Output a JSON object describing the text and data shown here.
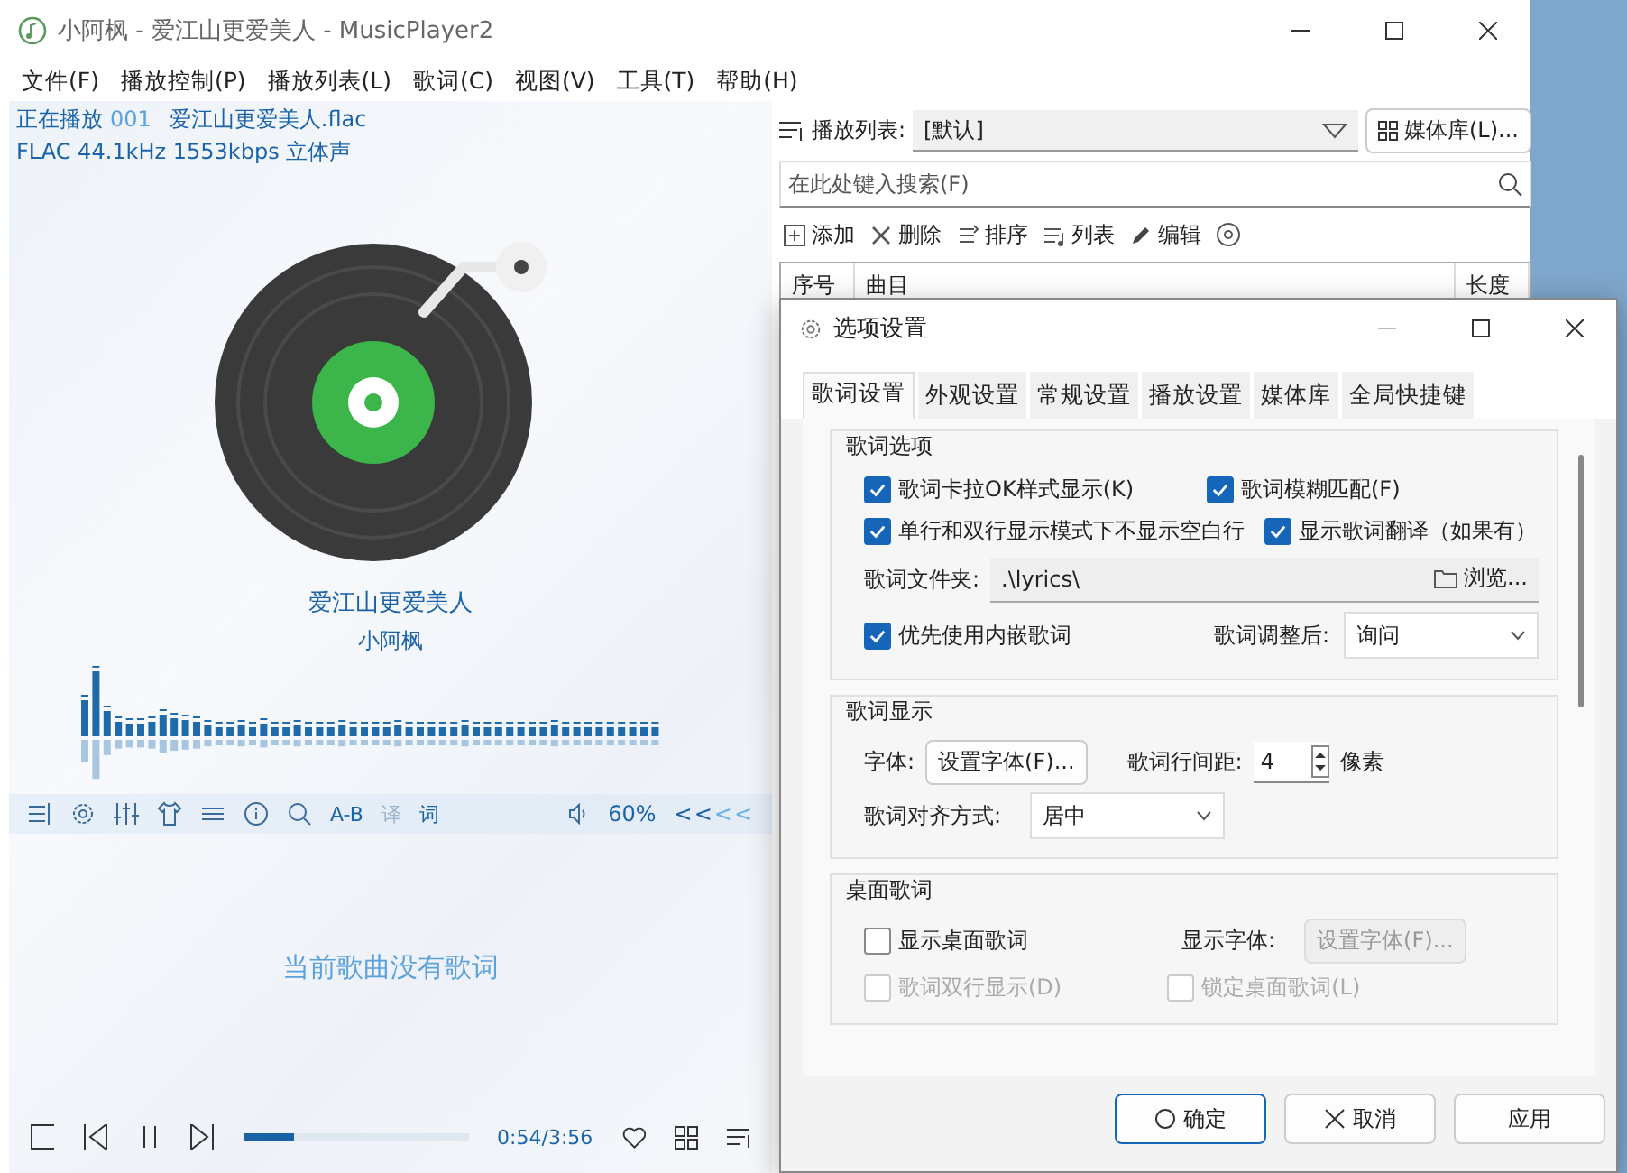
{
  "window": {
    "title": "小阿枫 - 爱江山更爱美人 - MusicPlayer2"
  },
  "menu": [
    "文件(F)",
    "播放控制(P)",
    "播放列表(L)",
    "歌词(C)",
    "视图(V)",
    "工具(T)",
    "帮助(H)"
  ],
  "now_playing": {
    "label": "正在播放",
    "index": "001",
    "file": "爱江山更爱美人.flac",
    "format": "FLAC 44.1kHz 1553kbps 立体声"
  },
  "song": {
    "title": "爱江山更爱美人",
    "artist": "小阿枫"
  },
  "toolbar": {
    "ab": "A-B",
    "translate": {
      "label": "译",
      "disabled": true
    },
    "lyrics": "词",
    "volume": "60%",
    "more_dark": "<<",
    "more_light": "<<"
  },
  "lyrics_message": "当前歌曲没有歌词",
  "playback": {
    "time": "0:54/3:56",
    "level": 0.23
  },
  "playlist": {
    "label": "播放列表:",
    "value": "[默认]",
    "library_button": "媒体库(L)...",
    "search_placeholder": "在此处键入搜索(F)",
    "actions": [
      "添加",
      "删除",
      "排序",
      "列表",
      "编辑"
    ],
    "columns": [
      "序号",
      "曲目",
      "长度"
    ]
  },
  "dialog": {
    "title": "选项设置",
    "tabs": [
      {
        "label": "歌词设置",
        "selected": true
      },
      {
        "label": "外观设置",
        "selected": false
      },
      {
        "label": "常规设置",
        "selected": false
      },
      {
        "label": "播放设置",
        "selected": false
      },
      {
        "label": "媒体库",
        "selected": false
      },
      {
        "label": "全局快捷键",
        "selected": false
      }
    ],
    "lyrics_options": {
      "title": "歌词选项",
      "checks": [
        {
          "label": "歌词卡拉OK样式显示(K)",
          "checked": true
        },
        {
          "label": "歌词模糊匹配(F)",
          "checked": true
        },
        {
          "label": "单行和双行显示模式下不显示空白行",
          "checked": true
        },
        {
          "label": "显示歌词翻译（如果有）",
          "checked": true
        }
      ],
      "folder_label": "歌词文件夹:",
      "folder_value": ".\\lyrics\\",
      "browse": "浏览...",
      "embedded": {
        "label": "优先使用内嵌歌词",
        "checked": true
      },
      "after_adjust_label": "歌词调整后:",
      "after_adjust_value": "询问"
    },
    "lyrics_display": {
      "title": "歌词显示",
      "font_label": "字体:",
      "font_button": "设置字体(F)...",
      "spacing_label": "歌词行间距:",
      "spacing_value": "4",
      "unit": "像素",
      "align_label": "歌词对齐方式:",
      "align_value": "居中"
    },
    "desktop_lyrics": {
      "title": "桌面歌词",
      "font_label": "显示字体:",
      "font_button": {
        "label": "设置字体(F)...",
        "disabled": true
      },
      "checks": [
        {
          "label": "显示桌面歌词",
          "checked": false,
          "disabled": false
        },
        {
          "label": "歌词双行显示(D)",
          "checked": false,
          "disabled": true
        },
        {
          "label": "锁定桌面歌词(L)",
          "checked": false,
          "disabled": true
        }
      ]
    },
    "buttons": [
      {
        "label": "确定",
        "kind": "ok"
      },
      {
        "label": "取消",
        "kind": "cancel"
      },
      {
        "label": "应用",
        "kind": "apply"
      }
    ]
  }
}
